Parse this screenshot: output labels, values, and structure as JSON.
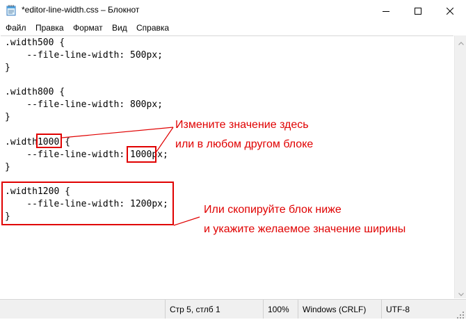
{
  "window": {
    "title": "*editor-line-width.css – Блокнот"
  },
  "menu": [
    {
      "label": "Файл"
    },
    {
      "label": "Правка"
    },
    {
      "label": "Формат"
    },
    {
      "label": "Вид"
    },
    {
      "label": "Справка"
    }
  ],
  "code_lines": [
    ".width500 {",
    "    --file-line-width: 500px;",
    "}",
    "",
    ".width800 {",
    "    --file-line-width: 800px;",
    "}",
    "",
    ".width1000 {",
    "    --file-line-width: 1000px;",
    "}",
    "",
    ".width1200 {",
    "    --file-line-width: 1200px;",
    "}"
  ],
  "annotations": {
    "change_value_line1": "Измените значение здесь",
    "change_value_line2": "или в любом другом блоке",
    "copy_block_line1": "Или скопируйте блок ниже",
    "copy_block_line2": "и укажите желаемое значение ширины"
  },
  "status": {
    "position": "Стр 5, стлб 1",
    "zoom": "100%",
    "line_endings": "Windows (CRLF)",
    "encoding": "UTF-8"
  },
  "colors": {
    "annotation": "#e00000"
  },
  "icons": {
    "app": "notepad-icon",
    "minimize": "minimize-icon",
    "maximize": "maximize-icon",
    "close": "close-icon"
  }
}
